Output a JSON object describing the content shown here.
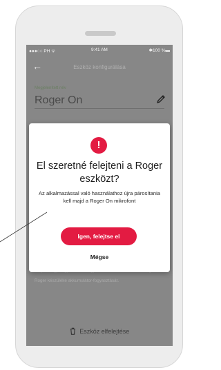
{
  "status_bar": {
    "carrier": "●●●○○ PH ᯤ",
    "time": "9:41 AM",
    "battery": "✱100 %▬"
  },
  "nav": {
    "title": "Eszköz konfigurálása",
    "back_icon": "arrow-left"
  },
  "field": {
    "label": "Megjelenített név",
    "value": "Roger On"
  },
  "background_info": "Kérjük, vegye figyelembe, hogy az üzemmód aktiválása megnöveli Roger készüléke akkumulátor-fogyasztását.",
  "forget_label": "Eszköz elfelejtése",
  "dialog": {
    "icon_glyph": "!",
    "title": "El szeretné felejteni a Roger eszközt?",
    "body": "Az alkalmazással való használathoz újra párosítania kell majd a Roger On mikrofont",
    "confirm_label": "Igen, felejtse el",
    "cancel_label": "Mégse"
  },
  "colors": {
    "accent": "#e31b42",
    "overlay": "#878787"
  }
}
